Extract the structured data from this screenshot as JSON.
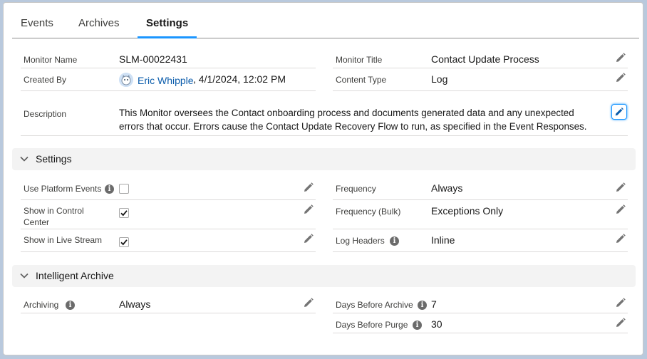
{
  "tabs": [
    {
      "label": "Events"
    },
    {
      "label": "Archives"
    },
    {
      "label": "Settings"
    }
  ],
  "details": {
    "monitor_name": {
      "label": "Monitor Name",
      "value": "SLM-00022431"
    },
    "monitor_title": {
      "label": "Monitor Title",
      "value": "Contact Update Process"
    },
    "created_by": {
      "label": "Created By",
      "user": "Eric Whipple",
      "date": ", 4/1/2024, 12:02 PM"
    },
    "content_type": {
      "label": "Content Type",
      "value": "Log"
    },
    "description": {
      "label": "Description",
      "line1": "This Monitor oversees the Contact onboarding process and documents generated data and any unexpected",
      "line2": "errors that occur. Errors cause the Contact Update Recovery Flow to run, as specified in the Event Responses."
    }
  },
  "settings_section": {
    "title": "Settings",
    "use_platform_events": {
      "label": "Use Platform Events",
      "checked": false
    },
    "show_in_control_center": {
      "label_line1": "Show in Control",
      "label_line2": "Center",
      "checked": true
    },
    "show_in_live_stream": {
      "label": "Show in Live Stream",
      "checked": true
    },
    "frequency": {
      "label": "Frequency",
      "value": "Always"
    },
    "frequency_bulk": {
      "label": "Frequency (Bulk)",
      "value": "Exceptions Only"
    },
    "log_headers": {
      "label": "Log Headers",
      "value": "Inline"
    }
  },
  "archive_section": {
    "title": "Intelligent Archive",
    "archiving": {
      "label": "Archiving",
      "value": "Always"
    },
    "days_before_archive": {
      "label": "Days Before Archive",
      "value": "7"
    },
    "days_before_purge": {
      "label": "Days Before Purge",
      "value": "30"
    }
  },
  "icons": {
    "edit": "pencil-icon",
    "info": "info-icon",
    "chevron": "chevron-down-icon",
    "check": "checkmark-icon"
  },
  "colors": {
    "accent": "#1b96ff",
    "link": "#0b5cab",
    "section_bg": "#f3f3f3"
  }
}
